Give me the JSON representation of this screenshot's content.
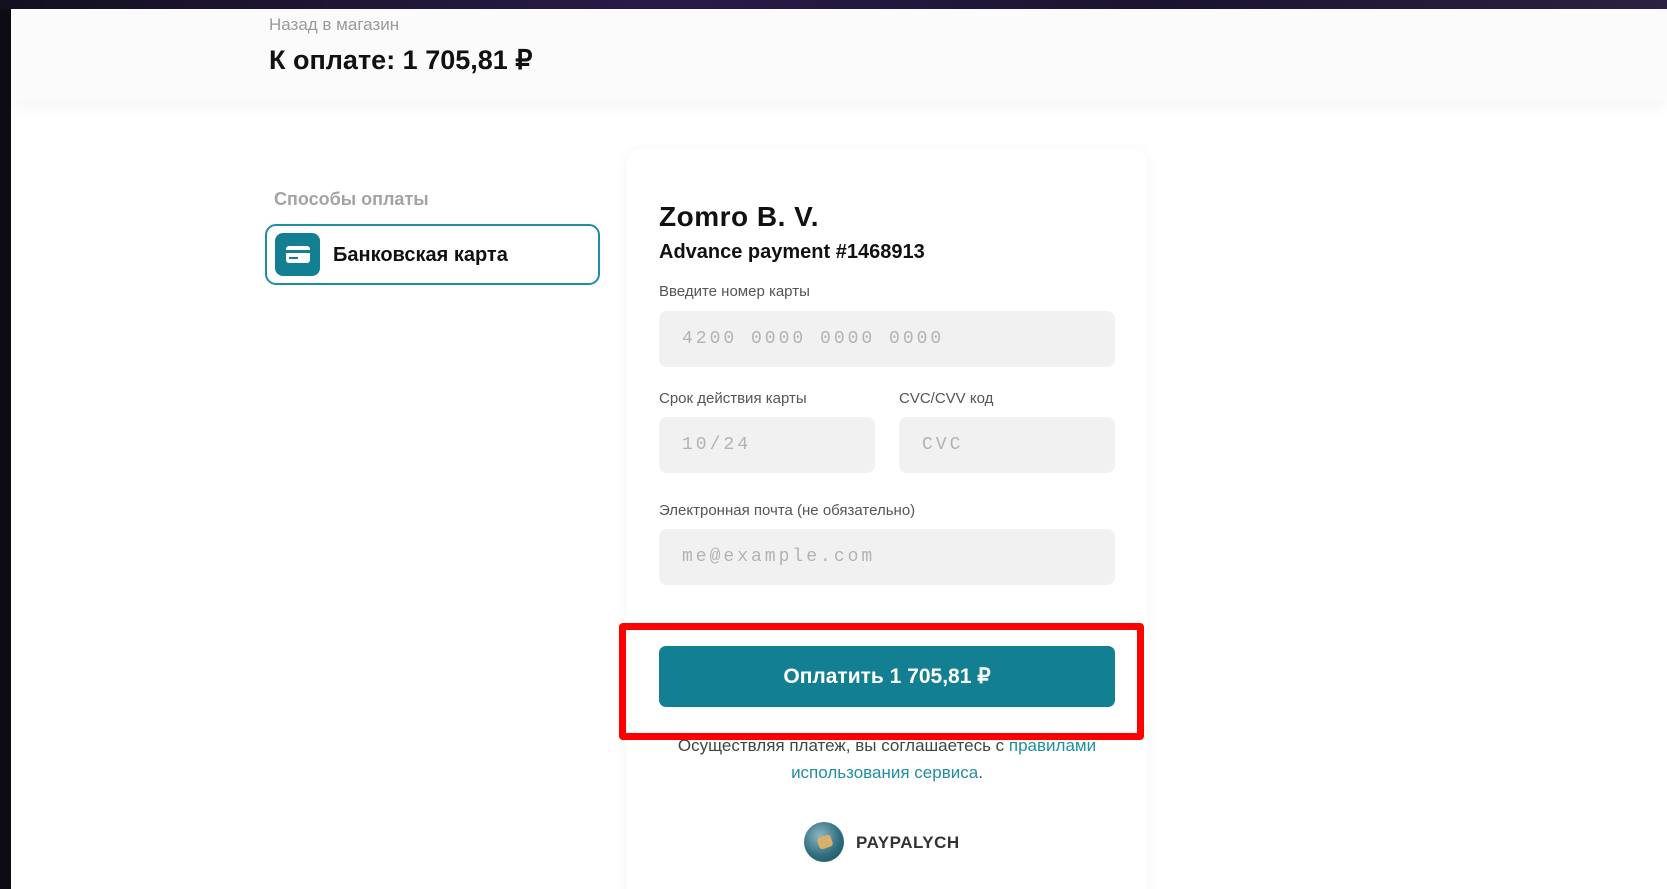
{
  "header": {
    "back_link": "Назад в магазин",
    "amount_title": "К оплате: 1 705,81 ₽"
  },
  "sidebar": {
    "title": "Способы оплаты",
    "methods": [
      {
        "label": "Банковская карта",
        "icon": "credit-card-icon",
        "selected": true
      }
    ]
  },
  "form": {
    "merchant": "Zomro B. V.",
    "invoice": "Advance payment #1468913",
    "card_number": {
      "label": "Введите номер карты",
      "placeholder": "4200 0000 0000 0000",
      "value": ""
    },
    "expiry": {
      "label": "Срок действия карты",
      "placeholder": "10/24",
      "value": ""
    },
    "cvc": {
      "label": "CVC/CVV код",
      "placeholder": "CVC",
      "value": ""
    },
    "email": {
      "label": "Электронная почта (не обязательно)",
      "placeholder": "me@example.com",
      "value": ""
    },
    "pay_button": "Оплатить 1 705,81 ₽",
    "terms_prefix": "Осуществляя платеж, вы соглашаетесь с ",
    "terms_link": "правилами использования сервиса",
    "terms_suffix": "."
  },
  "brand": {
    "name": "PAYPALYCH",
    "icon": "paypalych-logo-icon"
  },
  "colors": {
    "accent": "#127f92",
    "link": "#1f8ea1",
    "highlight_frame": "#ff0000",
    "input_bg": "#f1f1f1"
  }
}
